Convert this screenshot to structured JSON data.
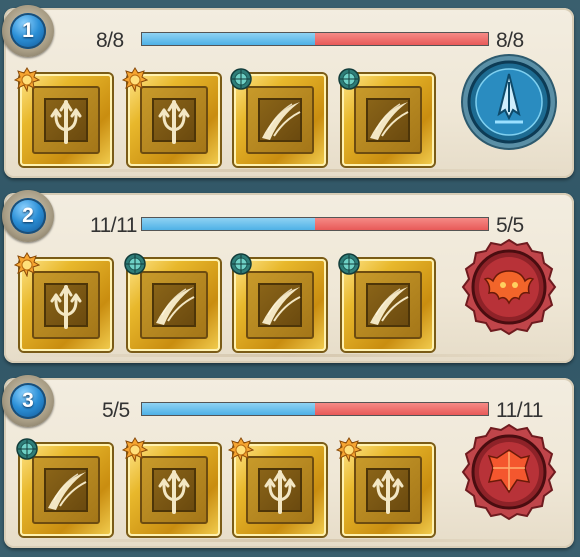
{
  "rows": [
    {
      "number": "1",
      "left_count": "8/8",
      "right_count": "8/8",
      "bar_blue_fraction": 0.5,
      "slots": [
        "trident-icon",
        "trident-icon",
        "slash-icon",
        "slash-icon"
      ],
      "slot_gems": [
        "orange-gem-icon",
        "orange-gem-icon",
        "teal-gem-icon",
        "teal-gem-icon"
      ],
      "medal": {
        "name": "blue-crystal-medal-icon",
        "color": "#2a7fae"
      }
    },
    {
      "number": "2",
      "left_count": "11/11",
      "right_count": "5/5",
      "bar_blue_fraction": 0.5,
      "slots": [
        "trident-icon",
        "slash-icon",
        "slash-icon",
        "slash-icon"
      ],
      "slot_gems": [
        "orange-gem-icon",
        "teal-gem-icon",
        "teal-gem-icon",
        "teal-gem-icon"
      ],
      "medal": {
        "name": "red-demon-medal-icon",
        "color": "#b8373d"
      }
    },
    {
      "number": "3",
      "left_count": "5/5",
      "right_count": "11/11",
      "bar_blue_fraction": 0.5,
      "slots": [
        "slash-icon",
        "trident-icon",
        "trident-icon",
        "trident-icon"
      ],
      "slot_gems": [
        "teal-gem-icon",
        "orange-gem-icon",
        "orange-gem-icon",
        "orange-gem-icon"
      ],
      "medal": {
        "name": "red-crystal-medal-icon",
        "color": "#b8373d"
      }
    }
  ],
  "colors": {
    "bar_blue": "#5ab8e9",
    "bar_red": "#ea6361",
    "gold": "#e8b82c"
  }
}
